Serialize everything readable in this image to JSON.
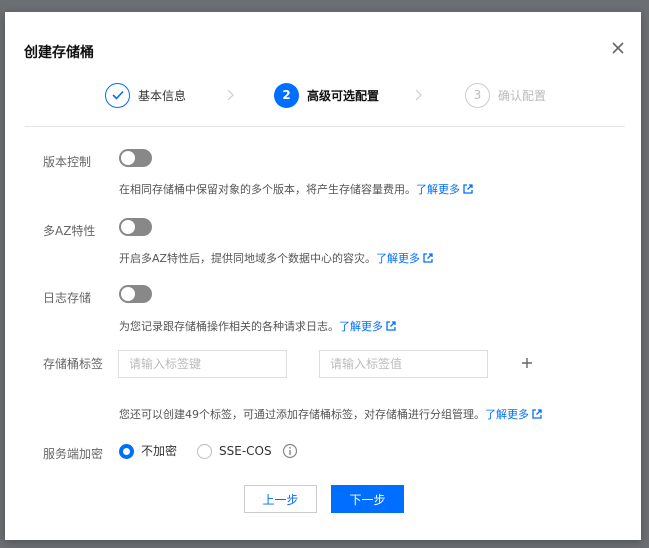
{
  "dialog": {
    "title": "创建存储桶"
  },
  "steps": [
    {
      "label": "基本信息",
      "number": "",
      "state": "done"
    },
    {
      "label": "高级可选配置",
      "number": "2",
      "state": "active"
    },
    {
      "label": "确认配置",
      "number": "3",
      "state": "todo"
    }
  ],
  "versioning": {
    "label": "版本控制",
    "enabled": false,
    "desc": "在相同存储桶中保留对象的多个版本，将产生存储容量费用。",
    "link": "了解更多"
  },
  "multi_az": {
    "label": "多AZ特性",
    "enabled": false,
    "desc": "开启多AZ特性后，提供同地域多个数据中心的容灾。",
    "link": "了解更多"
  },
  "logging": {
    "label": "日志存储",
    "enabled": false,
    "desc": "为您记录跟存储桶操作相关的各种请求日志。",
    "link": "了解更多"
  },
  "tags": {
    "label": "存储桶标签",
    "key_placeholder": "请输入标签键",
    "value_placeholder": "请输入标签值",
    "key_value": "",
    "value_value": "",
    "desc": "您还可以创建49个标签，可通过添加存储桶标签，对存储桶进行分组管理。",
    "link": "了解更多"
  },
  "encryption": {
    "label": "服务端加密",
    "options": [
      "不加密",
      "SSE-COS"
    ],
    "selected": "不加密"
  },
  "buttons": {
    "prev": "上一步",
    "next": "下一步"
  },
  "colors": {
    "accent": "#006eff",
    "toggle_off": "#888888"
  },
  "icons": {
    "close": "close-icon",
    "check": "check-icon",
    "chevron": "chevron-right-icon",
    "external": "external-link-icon",
    "plus": "plus-icon",
    "info": "info-icon"
  }
}
